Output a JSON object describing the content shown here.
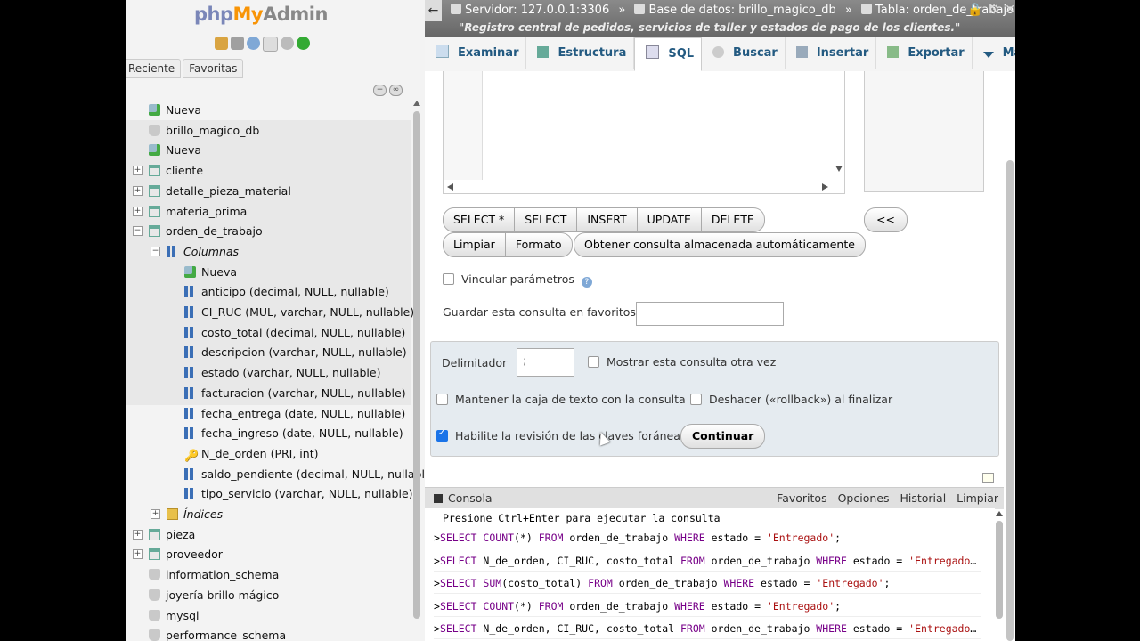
{
  "logo": {
    "php": "php",
    "my": "My",
    "admin": "Admin"
  },
  "nav": {
    "tabs": [
      "Reciente",
      "Favoritas"
    ],
    "tree": [
      {
        "label": "Nueva",
        "icon": "new-db-icon",
        "level": 0
      },
      {
        "label": "brillo_magico_db",
        "icon": "database-icon",
        "level": 0
      },
      {
        "label": "Nueva",
        "icon": "new-table-icon",
        "level": 1
      },
      {
        "label": "cliente",
        "icon": "table-icon",
        "level": 1,
        "toggle": "+"
      },
      {
        "label": "detalle_pieza_material",
        "icon": "table-icon",
        "level": 1,
        "toggle": "+"
      },
      {
        "label": "materia_prima",
        "icon": "table-icon",
        "level": 1,
        "toggle": "+"
      },
      {
        "label": "orden_de_trabajo",
        "icon": "table-icon",
        "level": 1,
        "toggle": "−"
      },
      {
        "label": "Columnas",
        "icon": "columns-icon",
        "level": 2,
        "toggle": "−",
        "italic": true
      },
      {
        "label": "Nueva",
        "icon": "new-column-icon",
        "level": 3
      },
      {
        "label": "anticipo (decimal, NULL, nullable)",
        "icon": "column-icon",
        "level": 3
      },
      {
        "label": "CI_RUC (MUL, varchar, NULL, nullable)",
        "icon": "column-icon",
        "level": 3
      },
      {
        "label": "costo_total (decimal, NULL, nullable)",
        "icon": "column-icon",
        "level": 3
      },
      {
        "label": "descripcion (varchar, NULL, nullable)",
        "icon": "column-icon",
        "level": 3
      },
      {
        "label": "estado (varchar, NULL, nullable)",
        "icon": "column-icon",
        "level": 3
      },
      {
        "label": "facturacion (varchar, NULL, nullable)",
        "icon": "column-icon",
        "level": 3
      },
      {
        "label": "fecha_entrega (date, NULL, nullable)",
        "icon": "column-icon",
        "level": 3
      },
      {
        "label": "fecha_ingreso (date, NULL, nullable)",
        "icon": "column-icon",
        "level": 3
      },
      {
        "label": "N_de_orden (PRI, int)",
        "icon": "key-icon",
        "level": 3
      },
      {
        "label": "saldo_pendiente (decimal, NULL, nullable)",
        "icon": "column-icon",
        "level": 3
      },
      {
        "label": "tipo_servicio (varchar, NULL, nullable)",
        "icon": "column-icon",
        "level": 3
      },
      {
        "label": "Índices",
        "icon": "index-icon",
        "level": 2,
        "toggle": "+",
        "italic": true
      },
      {
        "label": "pieza",
        "icon": "table-icon",
        "level": 1,
        "toggle": "+"
      },
      {
        "label": "proveedor",
        "icon": "table-icon",
        "level": 1,
        "toggle": "+"
      },
      {
        "label": "information_schema",
        "icon": "database-icon",
        "level": 0
      },
      {
        "label": "joyería brillo mágico",
        "icon": "database-icon",
        "level": 0
      },
      {
        "label": "mysql",
        "icon": "database-icon",
        "level": 0
      },
      {
        "label": "performance_schema",
        "icon": "database-icon",
        "level": 0
      }
    ]
  },
  "breadcrumb": {
    "server": "Servidor: 127.0.0.1:3306",
    "database": "Base de datos: brillo_magico_db",
    "table": "Tabla: orden_de_trabajo",
    "separator": "»",
    "motto": "\"Registro central de pedidos, servicios de taller y estados de pago de los clientes.\""
  },
  "tabs": [
    "Examinar",
    "Estructura",
    "SQL",
    "Buscar",
    "Insertar",
    "Exportar",
    "Más"
  ],
  "sql": {
    "buttons_row1": [
      "SELECT *",
      "SELECT",
      "INSERT",
      "UPDATE",
      "DELETE"
    ],
    "buttons_row2": [
      "Limpiar",
      "Formato",
      "Obtener consulta almacenada automáticamente"
    ],
    "insert_button": "<<",
    "bind_params": "Vincular parámetros",
    "save_label": "Guardar esta consulta en favoritos:",
    "delimiter_label": "Delimitador",
    "delimiter_value": ";",
    "show_again": "Mostrar esta consulta otra vez",
    "keep_box": "Mantener la caja de texto con la consulta",
    "rollback": "Deshacer («rollback») al finalizar",
    "fk_check": "Habilite la revisión de las claves foráneas",
    "go": "Continuar"
  },
  "console": {
    "title": "Consola",
    "links": [
      "Favoritos",
      "Opciones",
      "Historial",
      "Limpiar"
    ],
    "hint": "Presione Ctrl+Enter para ejecutar la consulta",
    "queries": [
      "SELECT COUNT(*) FROM orden_de_trabajo WHERE estado = 'Entregado';",
      "SELECT N_de_orden, CI_RUC, costo_total FROM orden_de_trabajo WHERE estado = 'Entregado';",
      "SELECT SUM(costo_total) FROM orden_de_trabajo WHERE estado = 'Entregado';",
      "SELECT COUNT(*) FROM orden_de_trabajo WHERE estado = 'Entregado';",
      "SELECT N_de_orden, CI_RUC, costo_total FROM orden_de_trabajo WHERE estado = 'Entregado';"
    ]
  },
  "colors": {
    "link": "#235a81",
    "topbar": "#777777",
    "panel": "#e5ebf0",
    "checked": "#1a73e8"
  }
}
